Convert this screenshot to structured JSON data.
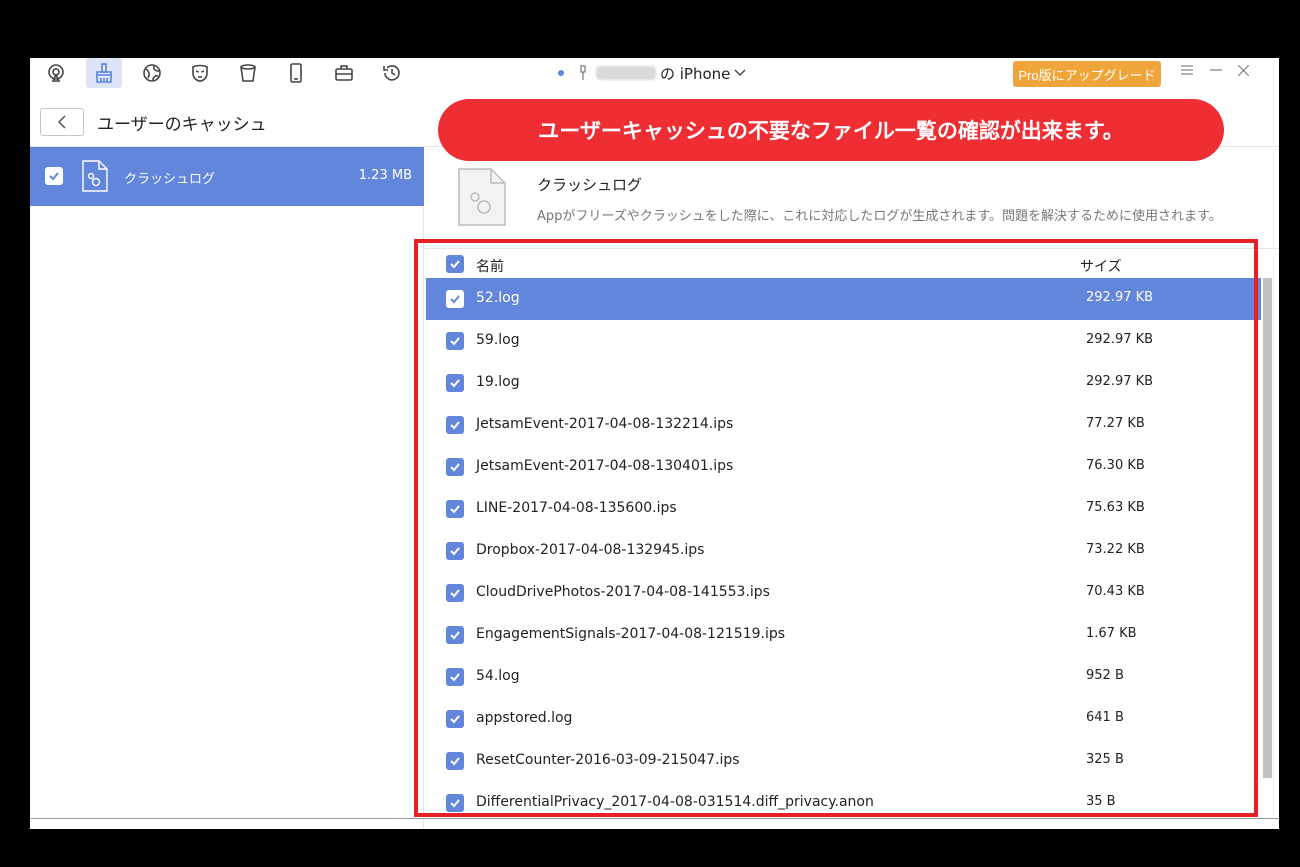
{
  "toolbar": {
    "icons": [
      "airplay-icon",
      "clean-brush-icon",
      "globe-icon",
      "mask-icon",
      "trash-bin-icon",
      "phone-icon",
      "toolbox-icon",
      "history-icon"
    ],
    "device_name": "の iPhone",
    "upgrade_label": "Pro版にアップグレード",
    "accent": "#6286dc",
    "upgrade_color": "#f0a53a"
  },
  "header": {
    "title": "ユーザーのキャッシュ"
  },
  "banner": {
    "text": "ユーザーキャッシュの不要なファイル一覧の確認が出来ます。",
    "color": "#ee2e33"
  },
  "sidebar": {
    "item": {
      "label": "クラッシュログ",
      "size": "1.23 MB",
      "checked": true
    }
  },
  "info": {
    "title": "クラッシュログ",
    "description": "Appがフリーズやクラッシュをした際に、これに対応したログが生成されます。問題を解決するために使用されます。"
  },
  "table": {
    "col_name": "名前",
    "col_size": "サイズ",
    "rows": [
      {
        "name": "52.log",
        "size": "292.97 KB"
      },
      {
        "name": "59.log",
        "size": "292.97 KB"
      },
      {
        "name": "19.log",
        "size": "292.97 KB"
      },
      {
        "name": "JetsamEvent-2017-04-08-132214.ips",
        "size": "77.27 KB"
      },
      {
        "name": "JetsamEvent-2017-04-08-130401.ips",
        "size": "76.30 KB"
      },
      {
        "name": "LINE-2017-04-08-135600.ips",
        "size": "75.63 KB"
      },
      {
        "name": "Dropbox-2017-04-08-132945.ips",
        "size": "73.22 KB"
      },
      {
        "name": "CloudDrivePhotos-2017-04-08-141553.ips",
        "size": "70.43 KB"
      },
      {
        "name": "EngagementSignals-2017-04-08-121519.ips",
        "size": "1.67 KB"
      },
      {
        "name": "54.log",
        "size": "952 B"
      },
      {
        "name": "appstored.log",
        "size": "641 B"
      },
      {
        "name": "ResetCounter-2016-03-09-215047.ips",
        "size": "325 B"
      },
      {
        "name": "DifferentialPrivacy_2017-04-08-031514.diff_privacy.anon",
        "size": "35 B"
      }
    ]
  }
}
